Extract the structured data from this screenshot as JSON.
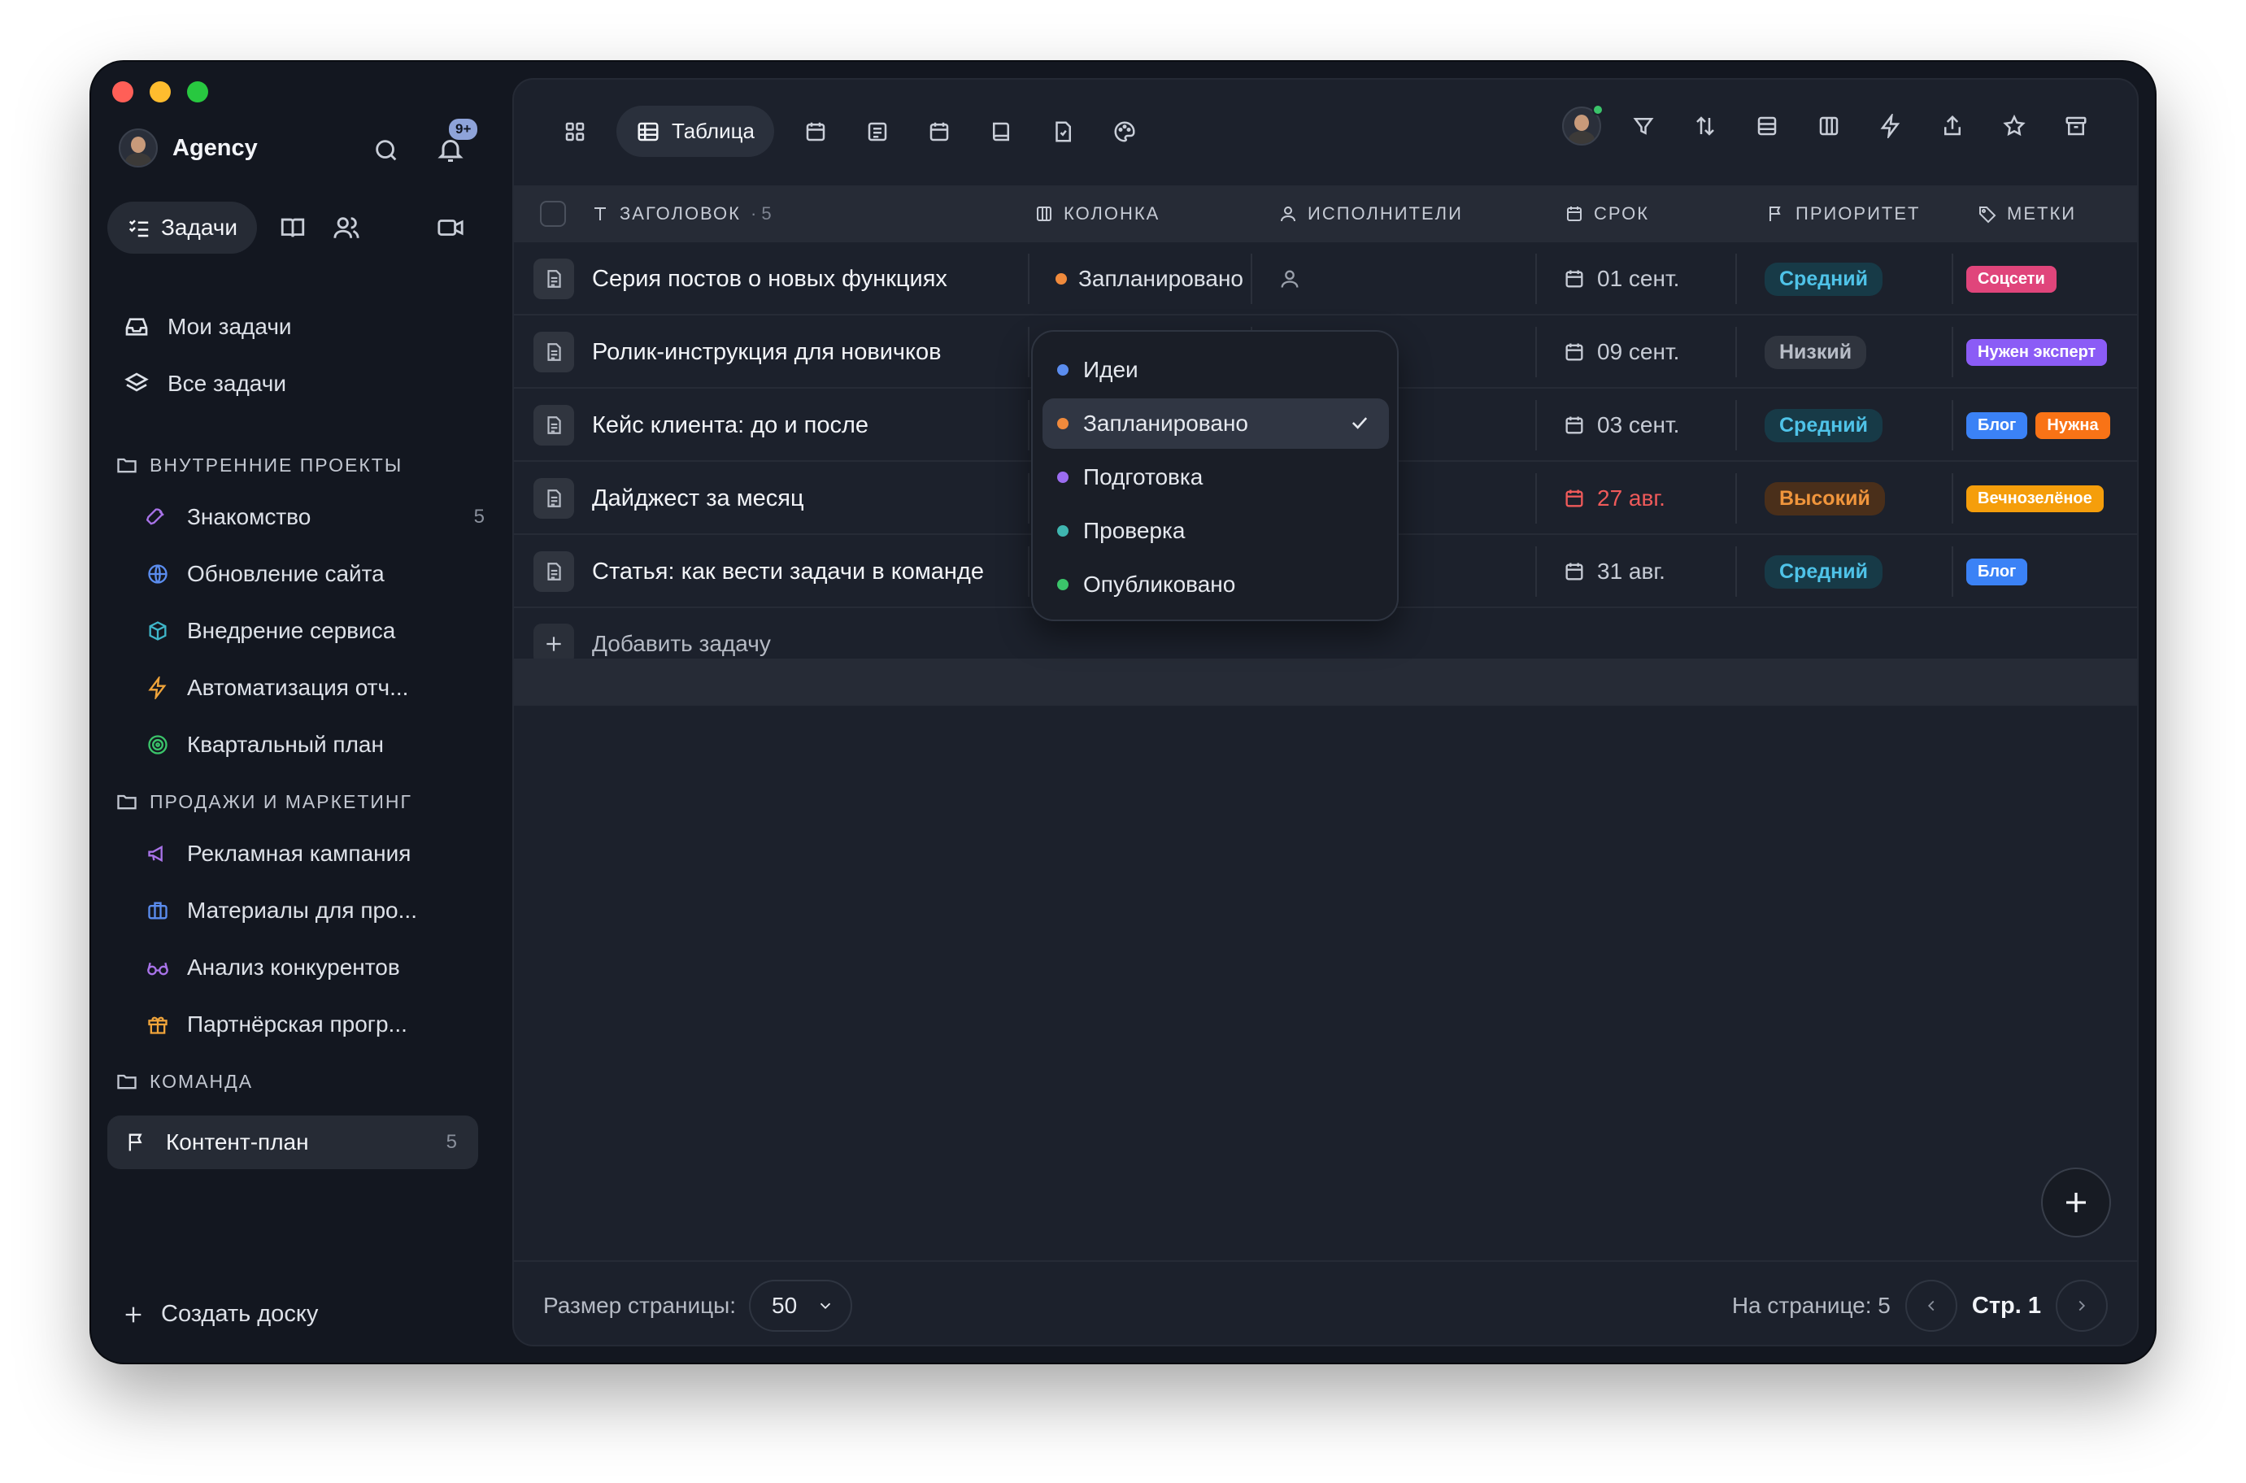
{
  "window": {
    "traffic_lights": [
      "#ff5f57",
      "#febc2e",
      "#28c840"
    ]
  },
  "workspace": {
    "name": "Agency",
    "notif_badge": "9+"
  },
  "sidebar": {
    "modes": {
      "active_label": "Задачи"
    },
    "nav": [
      {
        "label": "Мои задачи"
      },
      {
        "label": "Все задачи"
      }
    ],
    "sections": [
      {
        "label": "ВНУТРЕННИЕ ПРОЕКТЫ",
        "projects": [
          {
            "label": "Знакомство",
            "count": "5",
            "icon": "rocket-icon",
            "color": "#a873e8"
          },
          {
            "label": "Обновление сайта",
            "count": "",
            "icon": "globe-icon",
            "color": "#5b8def"
          },
          {
            "label": "Внедрение сервиса",
            "count": "",
            "icon": "box-icon",
            "color": "#3fb6c9"
          },
          {
            "label": "Автоматизация отч...",
            "count": "",
            "icon": "bolt-icon",
            "color": "#f0a43a"
          },
          {
            "label": "Квартальный план",
            "count": "",
            "icon": "target-icon",
            "color": "#3bc46a"
          }
        ]
      },
      {
        "label": "ПРОДАЖИ И МАРКЕТИНГ",
        "projects": [
          {
            "label": "Рекламная кампания",
            "count": "",
            "icon": "megaphone-icon",
            "color": "#a873e8"
          },
          {
            "label": "Материалы для про...",
            "count": "",
            "icon": "briefcase-icon",
            "color": "#5b8def"
          },
          {
            "label": "Анализ конкурентов",
            "count": "",
            "icon": "glasses-icon",
            "color": "#a873e8"
          },
          {
            "label": "Партнёрская прогр...",
            "count": "",
            "icon": "gift-icon",
            "color": "#f0a43a"
          }
        ]
      },
      {
        "label": "КОМАНДА",
        "projects": []
      }
    ],
    "active_project": {
      "label": "Контент-план",
      "count": "5"
    },
    "create_label": "Создать доску"
  },
  "toolbar": {
    "active_view": "Таблица"
  },
  "table": {
    "headers": {
      "title": "ЗАГОЛОВОК",
      "title_count": "· 5",
      "column": "КОЛОНКА",
      "assignees": "ИСПОЛНИТЕЛИ",
      "due": "СРОК",
      "priority": "ПРИОРИТЕТ",
      "tags": "МЕТКИ"
    },
    "rows": [
      {
        "title": "Серия постов о новых функциях",
        "status": "Запланировано",
        "status_color": "#f08a3c",
        "due": "01 сент.",
        "due_overdue": false,
        "priority": "Средний",
        "priority_kind": "mid",
        "tags": [
          {
            "label": "Соцсети",
            "color": "#e0457b"
          }
        ]
      },
      {
        "title": "Ролик-инструкция для новичков",
        "status": "",
        "status_color": "",
        "due": "09 сент.",
        "due_overdue": false,
        "priority": "Низкий",
        "priority_kind": "low",
        "tags": [
          {
            "label": "Нужен эксперт",
            "color": "#8b5cf6"
          }
        ]
      },
      {
        "title": "Кейс клиента: до и после",
        "status": "",
        "status_color": "",
        "due": "03 сент.",
        "due_overdue": false,
        "priority": "Средний",
        "priority_kind": "mid",
        "tags": [
          {
            "label": "Блог",
            "color": "#3b82f6"
          },
          {
            "label": "Нужна",
            "color": "#f97316"
          }
        ]
      },
      {
        "title": "Дайджест за месяц",
        "status": "",
        "status_color": "",
        "due": "27 авг.",
        "due_overdue": true,
        "priority": "Высокий",
        "priority_kind": "high",
        "tags": [
          {
            "label": "Вечнозелёное",
            "color": "#f59e0b"
          }
        ]
      },
      {
        "title": "Статья: как вести задачи в команде",
        "status": "",
        "status_color": "",
        "due": "31 авг.",
        "due_overdue": false,
        "priority": "Средний",
        "priority_kind": "mid",
        "tags": [
          {
            "label": "Блог",
            "color": "#3b82f6"
          }
        ]
      }
    ],
    "add_task_label": "Добавить задачу"
  },
  "dropdown": {
    "items": [
      {
        "label": "Идеи",
        "color": "#5b8def",
        "selected": false
      },
      {
        "label": "Запланировано",
        "color": "#f08a3c",
        "selected": true
      },
      {
        "label": "Подготовка",
        "color": "#9b6cf0",
        "selected": false
      },
      {
        "label": "Проверка",
        "color": "#3fb6b0",
        "selected": false
      },
      {
        "label": "Опубликовано",
        "color": "#3bc46a",
        "selected": false
      }
    ]
  },
  "footer": {
    "page_size_label": "Размер страницы:",
    "page_size": "50",
    "per_page": "На странице: 5",
    "page": "Стр. 1"
  },
  "colors": {
    "priority": {
      "mid": {
        "bg": "#173a47",
        "fg": "#4fc3e8"
      },
      "low": {
        "bg": "#2f343e",
        "fg": "#b8bdc7"
      },
      "high": {
        "bg": "#4a2f1a",
        "fg": "#f0953c"
      }
    },
    "overdue": "#ef5a5a"
  }
}
